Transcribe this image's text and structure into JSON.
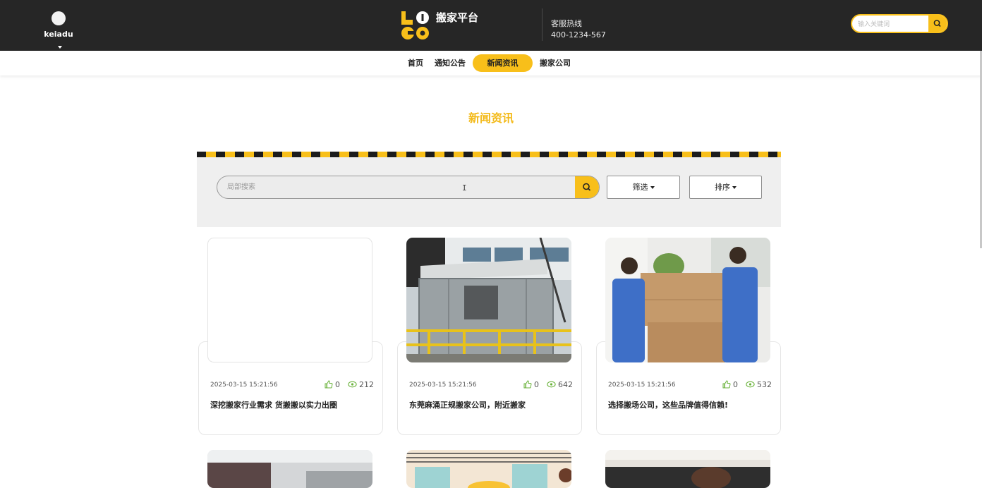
{
  "header": {
    "username": "keiadu",
    "logo_letters": [
      "L",
      "O",
      "G",
      "O"
    ],
    "brand": "搬家平台",
    "hotline_label": "客服热线",
    "hotline_number": "400-1234-567",
    "search_placeholder": "输入关键词"
  },
  "nav": {
    "items": [
      "首页",
      "通知公告",
      "新闻资讯",
      "搬家公司"
    ],
    "active": "新闻资讯"
  },
  "section_title": "新闻资讯",
  "filter": {
    "search_placeholder": "局部搜索",
    "filter_label": "筛选",
    "sort_label": "排序"
  },
  "cards": [
    {
      "date": "2025-03-15 15:21:56",
      "likes": "0",
      "views": "212",
      "title": "深挖搬家行业需求 货搬搬以实力出圈"
    },
    {
      "date": "2025-03-15 15:21:56",
      "likes": "0",
      "views": "642",
      "title": "东莞麻涌正规搬家公司，附近搬家"
    },
    {
      "date": "2025-03-15 15:21:56",
      "likes": "0",
      "views": "532",
      "title": "选择搬场公司，这些品牌值得信赖!"
    }
  ],
  "colors": {
    "accent": "#f8bf1a",
    "header_bg": "#262626",
    "panel_bg": "#efefef"
  }
}
